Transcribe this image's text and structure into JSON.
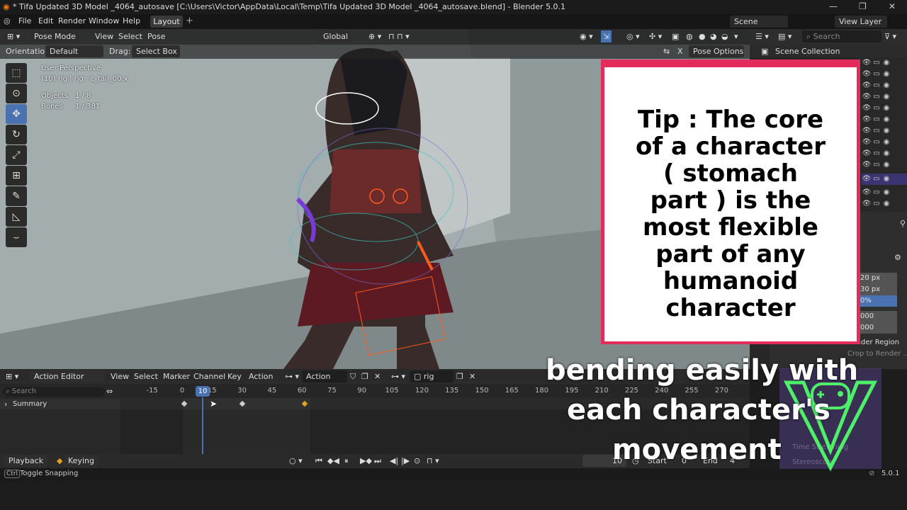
{
  "window": {
    "title": "* Tifa Updated 3D Model _4064_autosave [C:\\Users\\Victor\\AppData\\Local\\Temp\\Tifa Updated 3D Model _4064_autosave.blend] - Blender 5.0.1"
  },
  "menu": {
    "items": [
      "File",
      "Edit",
      "Render",
      "Window",
      "Help"
    ],
    "active_tab": "Layout",
    "add_tab": "+",
    "scene": "Scene",
    "view_layer": "View Layer"
  },
  "viewport": {
    "mode": "Pose Mode",
    "header_menus": [
      "View",
      "Select",
      "Pose"
    ],
    "orientation_global": "Global",
    "orientation_label": "Orientation:",
    "orientation_value": "Default",
    "drag_label": "Drag:",
    "drag_value": "Select Box",
    "pose_options": "Pose Options",
    "x_label": "X",
    "overlay": {
      "view": "User Perspective",
      "object": "(10) rig | rig : c_tail_00.x",
      "objects_label": "Objects",
      "objects_value": "1 / 8",
      "bones_label": "Bones",
      "bones_value": "1 / 381"
    }
  },
  "outliner": {
    "search_placeholder": "Search",
    "root": "Scene Collection"
  },
  "tip": {
    "text": "Tip : The core of a character ( stomach part ) is the most flexible part of any humanoid character",
    "lines": [
      "Tip : The core",
      "of a character",
      "( stomach",
      "part ) is the",
      "most flexible",
      "part of any",
      "humanoid",
      "character"
    ],
    "border_color": "#e32c5c"
  },
  "properties": {
    "fields": [
      "20 px",
      "30 px",
      "0%",
      "000",
      "000"
    ],
    "render_region": "Render Region",
    "crop": "Crop to Render ...",
    "time_stretching": "Time Stretching",
    "stereoscopy": "Stereoscopy"
  },
  "action_editor": {
    "editor_type": "Action Editor",
    "menus": [
      "View",
      "Select",
      "Marker",
      "Channel",
      "Key",
      "Action"
    ],
    "action_name": "Action",
    "slot_name": "rig",
    "search_placeholder": "Search",
    "summary": "Summary",
    "ticks": [
      "-15",
      "0",
      "15",
      "30",
      "45",
      "60",
      "75",
      "90",
      "105",
      "120",
      "135",
      "150",
      "165",
      "180",
      "195",
      "210",
      "225",
      "240",
      "255",
      "270"
    ],
    "current_frame": "10"
  },
  "playback": {
    "playback_label": "Playback",
    "keying_label": "Keying",
    "frame": "10",
    "start_label": "Start",
    "start_value": "0",
    "end_label": "End",
    "end_value": "4"
  },
  "status": {
    "key": "Ctrl",
    "hint": "Toggle Snapping",
    "version": "5.0.1"
  },
  "subtitle": {
    "line1": "bending easily with",
    "line2": "each character's",
    "line3": "movement"
  },
  "colors": {
    "accent": "#4a72b0",
    "viewport_bg": "#8f9a9b",
    "tip_border": "#e32c5c"
  }
}
